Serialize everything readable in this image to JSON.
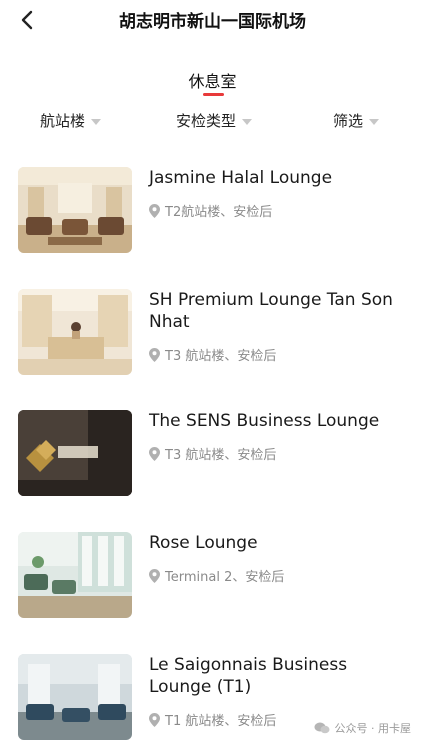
{
  "header": {
    "title": "胡志明市新山一国际机场"
  },
  "tabs": [
    {
      "label": "休息室",
      "active": true
    }
  ],
  "filters": [
    {
      "label": "航站楼"
    },
    {
      "label": "安检类型"
    },
    {
      "label": "筛选"
    }
  ],
  "lounges": [
    {
      "name": "Jasmine Halal Lounge",
      "location": "T2航站楼、安检后",
      "image": "jasmine-lounge-photo"
    },
    {
      "name": "SH Premium Lounge Tan Son Nhat",
      "location": "T3 航站楼、安检后",
      "image": "sh-premium-lounge-photo"
    },
    {
      "name": "The SENS Business Lounge",
      "location": "T3 航站楼、安检后",
      "image": "sens-lounge-photo"
    },
    {
      "name": "Rose Lounge",
      "location": "Terminal 2、安检后",
      "image": "rose-lounge-photo"
    },
    {
      "name": "Le Saigonnais Business Lounge (T1)",
      "location": "T1 航站楼、安检后",
      "image": "le-saigonnais-lounge-photo"
    }
  ],
  "watermark": {
    "text": "公众号 · 用卡屋"
  },
  "colors": {
    "accent": "#e8393a",
    "muted": "#8a8a8a"
  }
}
